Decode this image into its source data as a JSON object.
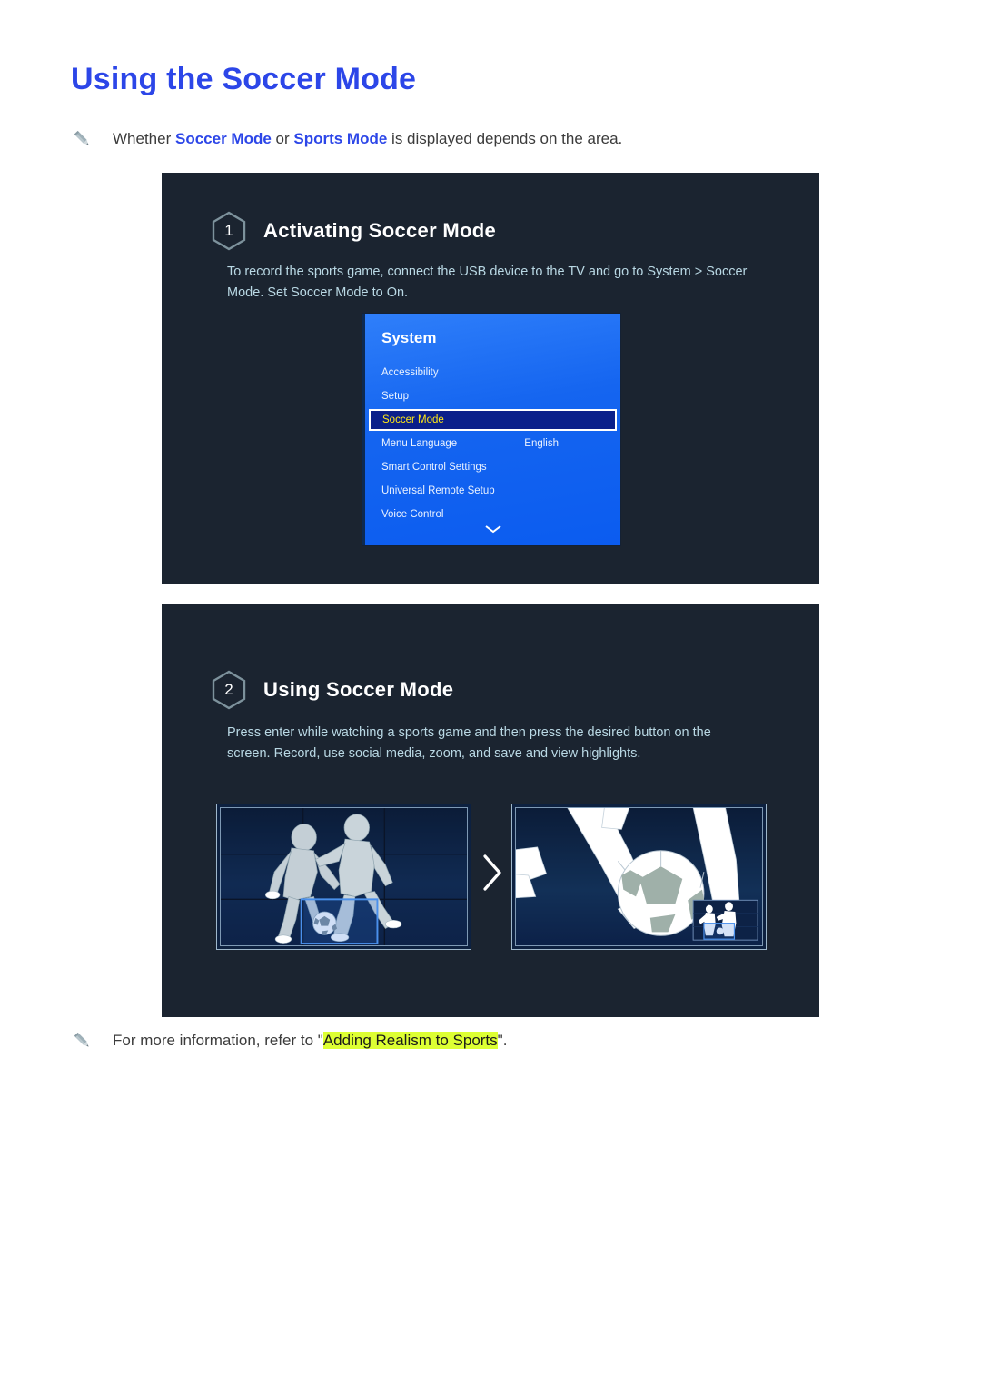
{
  "page": {
    "title": "Using the Soccer Mode"
  },
  "notes": {
    "intro": {
      "icon": "pencil-icon",
      "prefix": "Whether ",
      "keyword_1": "Soccer Mode",
      "middle": " or ",
      "keyword_2": "Sports Mode",
      "suffix": " is displayed depends on the area."
    },
    "footer": {
      "icon": "pencil-icon",
      "prefix": "For more information, refer to \"",
      "highlight": "Adding Realism to Sports",
      "suffix": "\"."
    }
  },
  "panels": [
    {
      "number": "1",
      "title": "Activating Soccer Mode",
      "description": "To record the sports game, connect the USB device to the TV and go to System > Soccer Mode. Set Soccer Mode to On."
    },
    {
      "number": "2",
      "title": "Using Soccer Mode",
      "description": "Press enter while watching a sports game and then press the desired button on the screen. Record, use social media, zoom, and save and view highlights."
    }
  ],
  "tv_menu": {
    "title": "System",
    "items": [
      {
        "label": "Accessibility",
        "value": "",
        "selected": false
      },
      {
        "label": "Setup",
        "value": "",
        "selected": false
      },
      {
        "label": "Soccer Mode",
        "value": "",
        "selected": true
      },
      {
        "label": "Menu Language",
        "value": "English",
        "selected": false
      },
      {
        "label": "Smart Control Settings",
        "value": "",
        "selected": false
      },
      {
        "label": "Universal Remote Setup",
        "value": "",
        "selected": false
      },
      {
        "label": "Voice Control",
        "value": "",
        "selected": false
      }
    ],
    "scroll_indicator": "chevron-down-icon"
  },
  "illustration": {
    "left_caption": "two soccer players with ball, zoom selection box on ball",
    "right_caption": "zoomed view of soccer ball and legs with picture-in-picture thumbnail",
    "transition_icon": "chevron-right-icon"
  },
  "colors": {
    "heading_blue": "#2c46e8",
    "panel_bg": "#1b2430",
    "panel_desc": "#b9d8e4",
    "menu_blue": "#1565f0",
    "menu_selected_bg": "#0a1f8a",
    "menu_selected_text": "#ffe814",
    "highlight_yellow": "#ddff33"
  }
}
